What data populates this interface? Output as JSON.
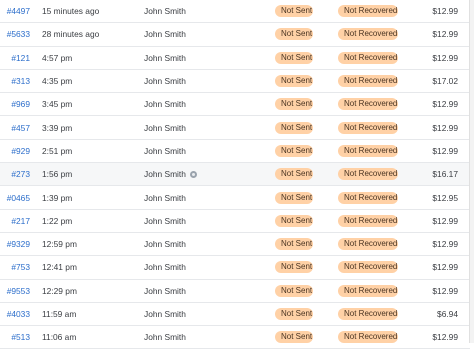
{
  "rows": [
    {
      "order": "#4497",
      "time": "15 minutes ago",
      "customer": "John Smith",
      "email_status": "Not Sent",
      "recovery_status": "Not Recovered",
      "total": "$12.99",
      "info": false
    },
    {
      "order": "#5633",
      "time": "28 minutes ago",
      "customer": "John Smith",
      "email_status": "Not Sent",
      "recovery_status": "Not Recovered",
      "total": "$12.99",
      "info": false
    },
    {
      "order": "#121",
      "time": "4:57 pm",
      "customer": "John Smith",
      "email_status": "Not Sent",
      "recovery_status": "Not Recovered",
      "total": "$12.99",
      "info": false
    },
    {
      "order": "#313",
      "time": "4:35 pm",
      "customer": "John Smith",
      "email_status": "Not Sent",
      "recovery_status": "Not Recovered",
      "total": "$17.02",
      "info": false
    },
    {
      "order": "#969",
      "time": "3:45 pm",
      "customer": "John Smith",
      "email_status": "Not Sent",
      "recovery_status": "Not Recovered",
      "total": "$12.99",
      "info": false
    },
    {
      "order": "#457",
      "time": "3:39 pm",
      "customer": "John Smith",
      "email_status": "Not Sent",
      "recovery_status": "Not Recovered",
      "total": "$12.99",
      "info": false
    },
    {
      "order": "#929",
      "time": "2:51 pm",
      "customer": "John Smith",
      "email_status": "Not Sent",
      "recovery_status": "Not Recovered",
      "total": "$12.99",
      "info": false
    },
    {
      "order": "#273",
      "time": "1:56 pm",
      "customer": "John Smith",
      "email_status": "Not Sent",
      "recovery_status": "Not Recovered",
      "total": "$16.17",
      "info": true
    },
    {
      "order": "#0465",
      "time": "1:39 pm",
      "customer": "John Smith",
      "email_status": "Not Sent",
      "recovery_status": "Not Recovered",
      "total": "$12.95",
      "info": false
    },
    {
      "order": "#217",
      "time": "1:22 pm",
      "customer": "John Smith",
      "email_status": "Not Sent",
      "recovery_status": "Not Recovered",
      "total": "$12.99",
      "info": false
    },
    {
      "order": "#9329",
      "time": "12:59 pm",
      "customer": "John Smith",
      "email_status": "Not Sent",
      "recovery_status": "Not Recovered",
      "total": "$12.99",
      "info": false
    },
    {
      "order": "#753",
      "time": "12:41 pm",
      "customer": "John Smith",
      "email_status": "Not Sent",
      "recovery_status": "Not Recovered",
      "total": "$12.99",
      "info": false
    },
    {
      "order": "#9553",
      "time": "12:29 pm",
      "customer": "John Smith",
      "email_status": "Not Sent",
      "recovery_status": "Not Recovered",
      "total": "$12.99",
      "info": false
    },
    {
      "order": "#4033",
      "time": "11:59 am",
      "customer": "John Smith",
      "email_status": "Not Sent",
      "recovery_status": "Not Recovered",
      "total": "$6.94",
      "info": false
    },
    {
      "order": "#513",
      "time": "11:06 am",
      "customer": "John Smith",
      "email_status": "Not Sent",
      "recovery_status": "Not Recovered",
      "total": "$12.99",
      "info": false
    }
  ],
  "colors": {
    "badge_bg": "#ffd1a6",
    "link": "#2c6ecb",
    "divider": "#e6e8eb"
  }
}
